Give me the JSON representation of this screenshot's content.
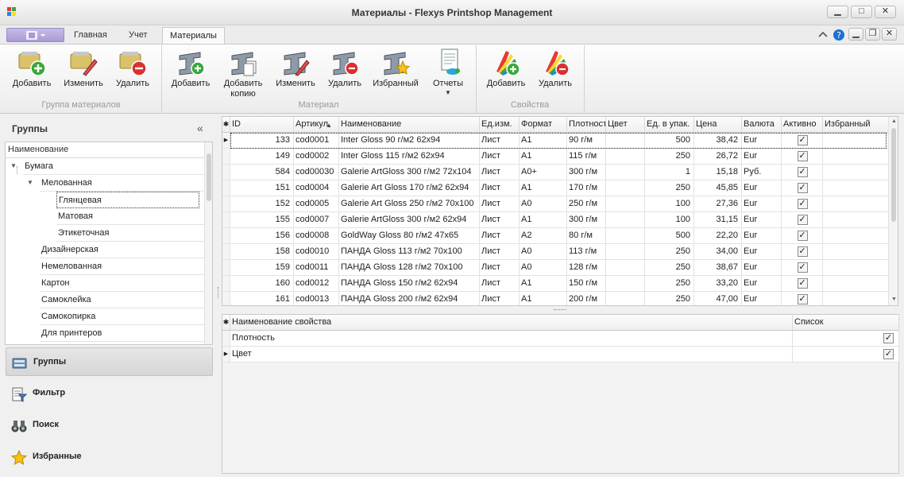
{
  "window": {
    "title": "Материалы - Flexys Printshop Management",
    "controls": [
      "minimize",
      "maximize",
      "close"
    ]
  },
  "ribbon_tabs": [
    "Главная",
    "Учет",
    "Материалы"
  ],
  "active_tab": "Материалы",
  "ribbon": {
    "group_material_group": {
      "caption": "Группа материалов",
      "buttons": [
        {
          "label": "Добавить",
          "icon": "folder-add-icon"
        },
        {
          "label": "Изменить",
          "icon": "folder-edit-icon"
        },
        {
          "label": "Удалить",
          "icon": "folder-delete-icon"
        }
      ]
    },
    "group_material": {
      "caption": "Материал",
      "buttons": [
        {
          "label": "Добавить",
          "icon": "steel-add-icon"
        },
        {
          "label": "Добавить копию",
          "icon": "steel-copy-icon"
        },
        {
          "label": "Изменить",
          "icon": "steel-edit-icon"
        },
        {
          "label": "Удалить",
          "icon": "steel-delete-icon"
        },
        {
          "label": "Избранный",
          "icon": "steel-favorite-icon"
        },
        {
          "label": "Отчеты",
          "icon": "reports-icon"
        }
      ]
    },
    "group_properties": {
      "caption": "Свойства",
      "buttons": [
        {
          "label": "Добавить",
          "icon": "palette-add-icon"
        },
        {
          "label": "Удалить",
          "icon": "palette-delete-icon"
        }
      ]
    }
  },
  "left_panel": {
    "title": "Группы",
    "tree_header": "Наименование",
    "tree": [
      {
        "label": "Бумага",
        "level": 0,
        "expanded": true
      },
      {
        "label": "Мелованная",
        "level": 1,
        "expanded": true
      },
      {
        "label": "Глянцевая",
        "level": 2,
        "selected": true
      },
      {
        "label": "Матовая",
        "level": 2
      },
      {
        "label": "Этикеточная",
        "level": 2
      },
      {
        "label": "Дизайнерская",
        "level": 1
      },
      {
        "label": "Немелованная",
        "level": 1
      },
      {
        "label": "Картон",
        "level": 1
      },
      {
        "label": "Самоклейка",
        "level": 1
      },
      {
        "label": "Самокопирка",
        "level": 1
      },
      {
        "label": "Для принтеров",
        "level": 1
      }
    ],
    "nav": [
      {
        "label": "Группы",
        "icon": "groups-icon",
        "active": true
      },
      {
        "label": "Фильтр",
        "icon": "filter-icon"
      },
      {
        "label": "Поиск",
        "icon": "binoculars-icon"
      },
      {
        "label": "Избранные",
        "icon": "star-icon"
      }
    ]
  },
  "grid": {
    "columns": [
      "ID",
      "Артикул",
      "Наименование",
      "Ед.изм.",
      "Формат",
      "Плотность",
      "Цвет",
      "Ед. в упак.",
      "Цена",
      "Валюта",
      "Активно",
      "Избранный"
    ],
    "sort_column": "Артикул",
    "rows": [
      {
        "id": "133",
        "article": "cod0001",
        "name": "Inter Gloss 90 г/м2 62x94",
        "unit": "Лист",
        "format": "A1",
        "density": "90 г/м",
        "color": "",
        "pack": "500",
        "price": "38,42",
        "currency": "Eur",
        "active": true,
        "favorite": false
      },
      {
        "id": "149",
        "article": "cod0002",
        "name": "Inter Gloss  115 г/м2 62x94",
        "unit": "Лист",
        "format": "A1",
        "density": "115 г/м",
        "color": "",
        "pack": "250",
        "price": "26,72",
        "currency": "Eur",
        "active": true,
        "favorite": false
      },
      {
        "id": "584",
        "article": "cod00030",
        "name": "Galerie ArtGloss 300 г/м2 72x104",
        "unit": "Лист",
        "format": "A0+",
        "density": "300 г/м",
        "color": "",
        "pack": "1",
        "price": "15,18",
        "currency": "Руб.",
        "active": true,
        "favorite": false
      },
      {
        "id": "151",
        "article": "cod0004",
        "name": "Galerie Art Gloss 170 г/м2 62x94",
        "unit": "Лист",
        "format": "A1",
        "density": "170 г/м",
        "color": "",
        "pack": "250",
        "price": "45,85",
        "currency": "Eur",
        "active": true,
        "favorite": false
      },
      {
        "id": "152",
        "article": "cod0005",
        "name": "Galerie Art Gloss 250 г/м2 70x100",
        "unit": "Лист",
        "format": "A0",
        "density": "250 г/м",
        "color": "",
        "pack": "100",
        "price": "27,36",
        "currency": "Eur",
        "active": true,
        "favorite": false
      },
      {
        "id": "155",
        "article": "cod0007",
        "name": "Galerie ArtGloss 300 г/м2 62x94",
        "unit": "Лист",
        "format": "A1",
        "density": "300 г/м",
        "color": "",
        "pack": "100",
        "price": "31,15",
        "currency": "Eur",
        "active": true,
        "favorite": false
      },
      {
        "id": "156",
        "article": "cod0008",
        "name": "GoldWay Gloss 80 г/м2 47x65",
        "unit": "Лист",
        "format": "A2",
        "density": "80 г/м",
        "color": "",
        "pack": "500",
        "price": "22,20",
        "currency": "Eur",
        "active": true,
        "favorite": false
      },
      {
        "id": "158",
        "article": "cod0010",
        "name": "ПАНДА Gloss 113 г/м2 70x100",
        "unit": "Лист",
        "format": "A0",
        "density": "113 г/м",
        "color": "",
        "pack": "250",
        "price": "34,00",
        "currency": "Eur",
        "active": true,
        "favorite": false
      },
      {
        "id": "159",
        "article": "cod0011",
        "name": "ПАНДА Gloss 128 г/м2 70x100",
        "unit": "Лист",
        "format": "A0",
        "density": "128 г/м",
        "color": "",
        "pack": "250",
        "price": "38,67",
        "currency": "Eur",
        "active": true,
        "favorite": false
      },
      {
        "id": "160",
        "article": "cod0012",
        "name": "ПАНДА Gloss 150 г/м2 62x94",
        "unit": "Лист",
        "format": "A1",
        "density": "150 г/м",
        "color": "",
        "pack": "250",
        "price": "33,20",
        "currency": "Eur",
        "active": true,
        "favorite": false
      },
      {
        "id": "161",
        "article": "cod0013",
        "name": "ПАНДА Gloss 200 г/м2 62x94",
        "unit": "Лист",
        "format": "A1",
        "density": "200 г/м",
        "color": "",
        "pack": "250",
        "price": "47,00",
        "currency": "Eur",
        "active": true,
        "favorite": false
      }
    ]
  },
  "property_grid": {
    "columns": [
      "Наименование свойства",
      "Список"
    ],
    "rows": [
      {
        "name": "Плотность",
        "list": true
      },
      {
        "name": "Цвет",
        "list": true
      }
    ]
  },
  "colors": {
    "accent": "#a99ad4",
    "selection_border": "#222222",
    "header_bg": "#efefef"
  }
}
